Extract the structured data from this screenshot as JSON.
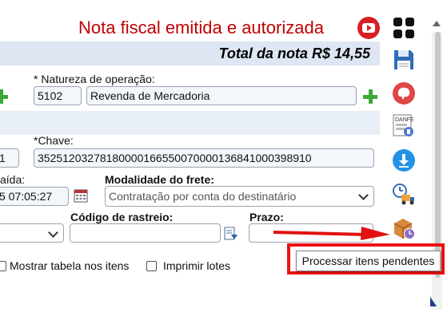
{
  "header": {
    "status_message": "Nota fiscal emitida e autorizada",
    "total": "Total da nota R$ 14,55"
  },
  "form": {
    "natureza_label": "* Natureza de operação:",
    "natureza_code": "5102",
    "natureza_desc": "Revenda de Mercadoria",
    "serie_value": "1",
    "chave_label": "*Chave:",
    "chave_value": "35251203278180000166550070000136841000398910",
    "saida_label": "aída:",
    "saida_value": "5 07:05:27",
    "modalidade_label": "Modalidade do frete:",
    "modalidade_value": "Contratação por conta do destinatário",
    "rastreio_label": "Código de rastreio:",
    "rastreio_value": "",
    "prazo_label": "Prazo:",
    "prazo_value": "",
    "mostrar_tabela_label": "Mostrar tabela nos itens",
    "imprimir_lotes_label": "Imprimir lotes"
  },
  "sidebar": {
    "icons": [
      "grid-menu-icon",
      "save-floppy-icon",
      "brain-icon",
      "danfe-icon",
      "download-icon",
      "delivery-truck-clock-icon",
      "package-clock-icon"
    ],
    "danfe_text": "DANFE"
  },
  "tooltip": {
    "text": "Processar itens pendentes"
  },
  "colors": {
    "status_red": "#c00000",
    "highlight_red": "#e11111",
    "plus_green": "#3aa935"
  }
}
